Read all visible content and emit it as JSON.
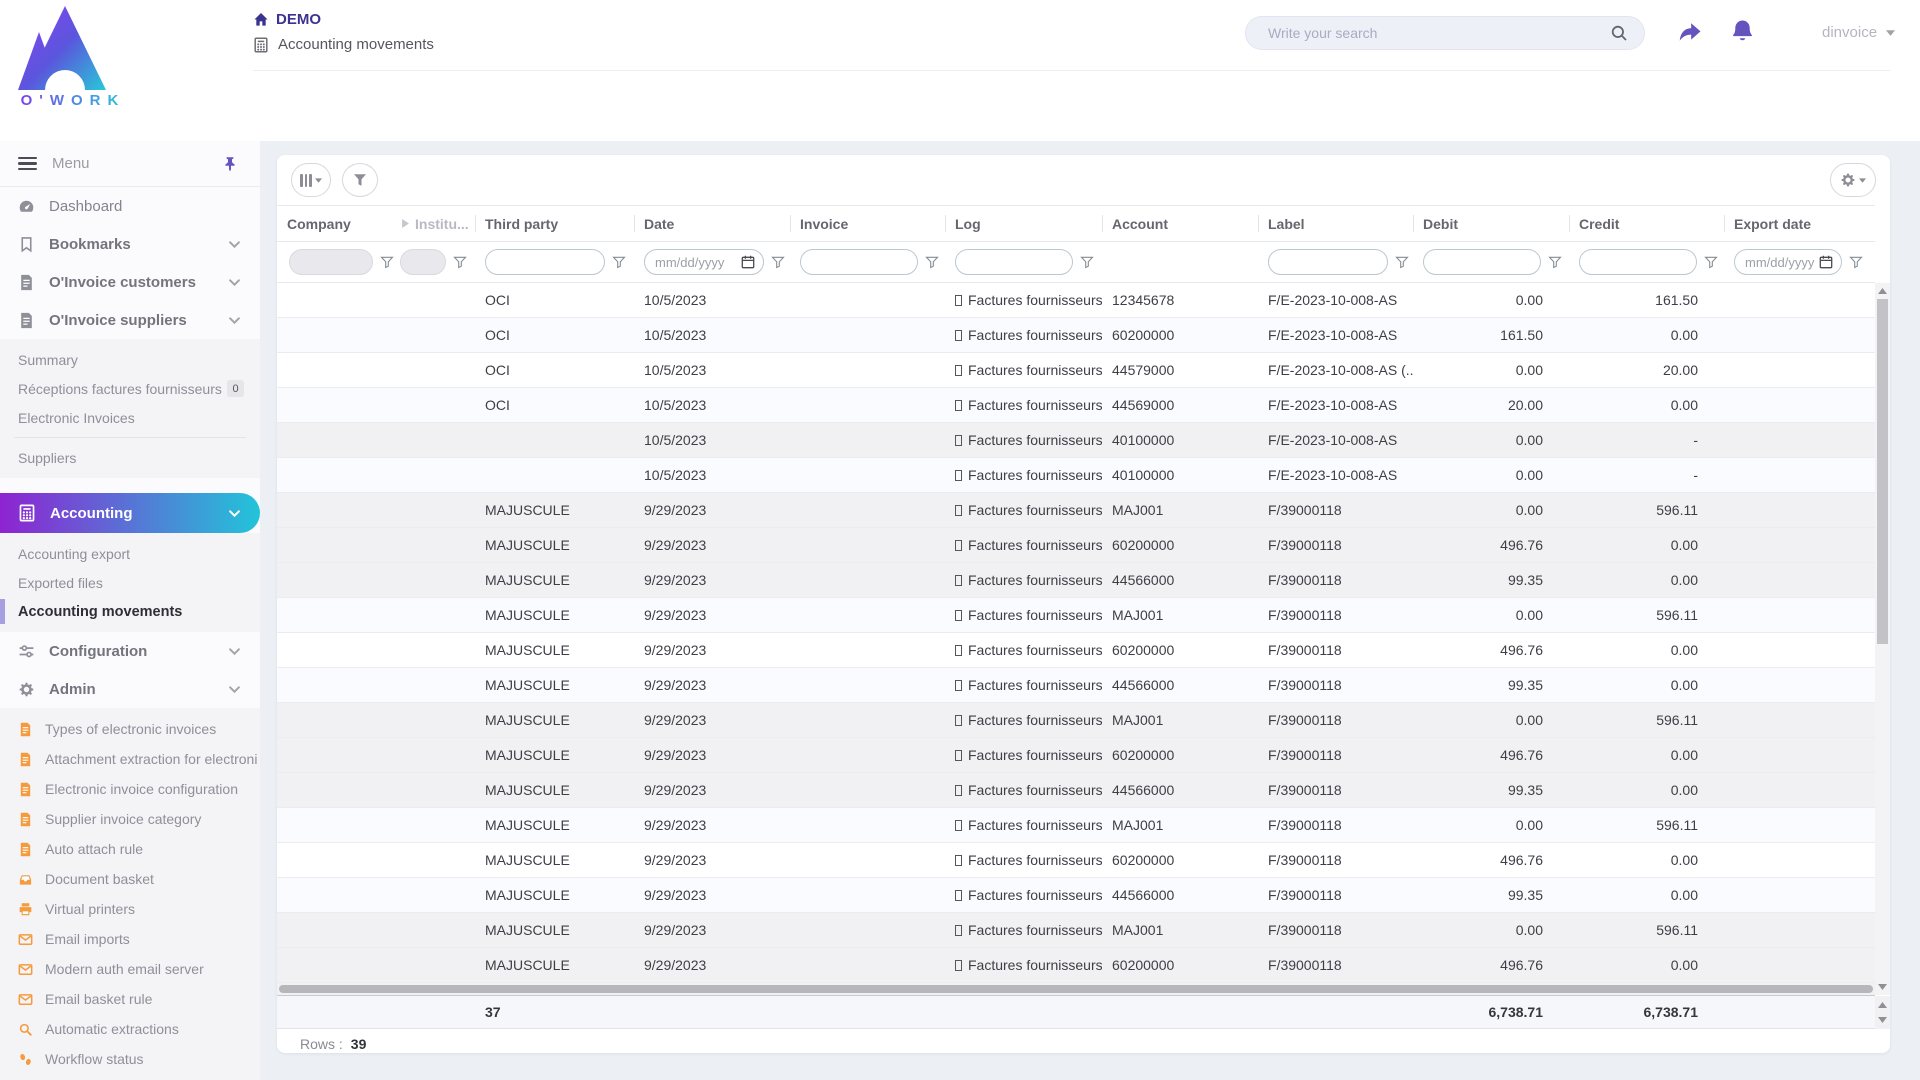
{
  "colors": {
    "accent_purple": "#6554c0",
    "grad_start": "#8e23d2",
    "grad_end": "#22c4d9",
    "breadcrumb_title": "#3b3390",
    "admin_orange": "#f39b3d",
    "active_bar": "#a89fe0"
  },
  "topbar": {
    "logo_text": "O'WORK",
    "breadcrumb_title": "DEMO",
    "breadcrumb_page": "Accounting movements",
    "search_placeholder": "Write your search",
    "username": "dinvoice"
  },
  "sidebar": {
    "menu_label": "Menu",
    "dashboard": "Dashboard",
    "bookmarks": "Bookmarks",
    "oinvoice_customers": "O'Invoice customers",
    "oinvoice_suppliers": "O'Invoice suppliers",
    "suppliers_submenu": [
      {
        "label": "Summary"
      },
      {
        "label": "Réceptions factures fournisseurs",
        "badge": "0"
      },
      {
        "label": "Electronic Invoices"
      },
      {
        "divider": true
      },
      {
        "label": "Suppliers"
      }
    ],
    "accounting": "Accounting",
    "accounting_submenu": [
      {
        "label": "Accounting export"
      },
      {
        "label": "Exported files"
      },
      {
        "label": "Accounting movements",
        "active": true
      }
    ],
    "configuration": "Configuration",
    "admin": "Admin",
    "admin_submenu": [
      {
        "label": "Types of electronic invoices",
        "icon": "doc"
      },
      {
        "label": "Attachment extraction for electroni",
        "icon": "doc"
      },
      {
        "label": "Electronic invoice configuration",
        "icon": "doc"
      },
      {
        "label": "Supplier invoice category",
        "icon": "doc"
      },
      {
        "label": "Auto attach rule",
        "icon": "doc"
      },
      {
        "label": "Document basket",
        "icon": "basket"
      },
      {
        "label": "Virtual printers",
        "icon": "printer"
      },
      {
        "label": "Email imports",
        "icon": "mail"
      },
      {
        "label": "Modern auth email server",
        "icon": "mail"
      },
      {
        "label": "Email basket rule",
        "icon": "mail"
      },
      {
        "label": "Automatic extractions",
        "icon": "searchglass"
      },
      {
        "label": "Workflow status",
        "icon": "steps"
      }
    ]
  },
  "table": {
    "columns": [
      {
        "key": "company",
        "label": "Company"
      },
      {
        "key": "institution",
        "label": "Institu..."
      },
      {
        "key": "third_party",
        "label": "Third party"
      },
      {
        "key": "date",
        "label": "Date"
      },
      {
        "key": "invoice",
        "label": "Invoice"
      },
      {
        "key": "log",
        "label": "Log"
      },
      {
        "key": "account",
        "label": "Account"
      },
      {
        "key": "label",
        "label": "Label"
      },
      {
        "key": "debit",
        "label": "Debit"
      },
      {
        "key": "credit",
        "label": "Credit"
      },
      {
        "key": "export_date",
        "label": "Export date"
      }
    ],
    "date_placeholder": "mm/dd/yyyy",
    "rows": [
      {
        "company": "",
        "institution": "",
        "third_party": "OCI",
        "date": "10/5/2023",
        "invoice": "",
        "log": "Factures fournisseurs",
        "account": "12345678",
        "label": "F/E-2023-10-008-AS",
        "debit": "0.00",
        "credit": "161.50",
        "export_date": "",
        "shade": "w"
      },
      {
        "company": "",
        "institution": "",
        "third_party": "OCI",
        "date": "10/5/2023",
        "invoice": "",
        "log": "Factures fournisseurs",
        "account": "60200000",
        "label": "F/E-2023-10-008-AS",
        "debit": "161.50",
        "credit": "0.00",
        "export_date": "",
        "shade": "l"
      },
      {
        "company": "",
        "institution": "",
        "third_party": "OCI",
        "date": "10/5/2023",
        "invoice": "",
        "log": "Factures fournisseurs",
        "account": "44579000",
        "label": "F/E-2023-10-008-AS (...",
        "debit": "0.00",
        "credit": "20.00",
        "export_date": "",
        "shade": "w"
      },
      {
        "company": "",
        "institution": "",
        "third_party": "OCI",
        "date": "10/5/2023",
        "invoice": "",
        "log": "Factures fournisseurs",
        "account": "44569000",
        "label": "F/E-2023-10-008-AS",
        "debit": "20.00",
        "credit": "0.00",
        "export_date": "",
        "shade": "l"
      },
      {
        "company": "",
        "institution": "",
        "third_party": "",
        "date": "10/5/2023",
        "invoice": "",
        "log": "Factures fournisseurs",
        "account": "40100000",
        "label": "F/E-2023-10-008-AS",
        "debit": "0.00",
        "credit": "-",
        "export_date": "",
        "shade": "g"
      },
      {
        "company": "",
        "institution": "",
        "third_party": "",
        "date": "10/5/2023",
        "invoice": "",
        "log": "Factures fournisseurs",
        "account": "40100000",
        "label": "F/E-2023-10-008-AS",
        "debit": "0.00",
        "credit": "-",
        "export_date": "",
        "shade": "l"
      },
      {
        "company": "",
        "institution": "",
        "third_party": "MAJUSCULE",
        "date": "9/29/2023",
        "invoice": "",
        "log": "Factures fournisseurs",
        "account": "MAJ001",
        "label": "F/39000118",
        "debit": "0.00",
        "credit": "596.11",
        "export_date": "",
        "shade": "g"
      },
      {
        "company": "",
        "institution": "",
        "third_party": "MAJUSCULE",
        "date": "9/29/2023",
        "invoice": "",
        "log": "Factures fournisseurs",
        "account": "60200000",
        "label": "F/39000118",
        "debit": "496.76",
        "credit": "0.00",
        "export_date": "",
        "shade": "g"
      },
      {
        "company": "",
        "institution": "",
        "third_party": "MAJUSCULE",
        "date": "9/29/2023",
        "invoice": "",
        "log": "Factures fournisseurs",
        "account": "44566000",
        "label": "F/39000118",
        "debit": "99.35",
        "credit": "0.00",
        "export_date": "",
        "shade": "g"
      },
      {
        "company": "",
        "institution": "",
        "third_party": "MAJUSCULE",
        "date": "9/29/2023",
        "invoice": "",
        "log": "Factures fournisseurs",
        "account": "MAJ001",
        "label": "F/39000118",
        "debit": "0.00",
        "credit": "596.11",
        "export_date": "",
        "shade": "l"
      },
      {
        "company": "",
        "institution": "",
        "third_party": "MAJUSCULE",
        "date": "9/29/2023",
        "invoice": "",
        "log": "Factures fournisseurs",
        "account": "60200000",
        "label": "F/39000118",
        "debit": "496.76",
        "credit": "0.00",
        "export_date": "",
        "shade": "w"
      },
      {
        "company": "",
        "institution": "",
        "third_party": "MAJUSCULE",
        "date": "9/29/2023",
        "invoice": "",
        "log": "Factures fournisseurs",
        "account": "44566000",
        "label": "F/39000118",
        "debit": "99.35",
        "credit": "0.00",
        "export_date": "",
        "shade": "l"
      },
      {
        "company": "",
        "institution": "",
        "third_party": "MAJUSCULE",
        "date": "9/29/2023",
        "invoice": "",
        "log": "Factures fournisseurs",
        "account": "MAJ001",
        "label": "F/39000118",
        "debit": "0.00",
        "credit": "596.11",
        "export_date": "",
        "shade": "g"
      },
      {
        "company": "",
        "institution": "",
        "third_party": "MAJUSCULE",
        "date": "9/29/2023",
        "invoice": "",
        "log": "Factures fournisseurs",
        "account": "60200000",
        "label": "F/39000118",
        "debit": "496.76",
        "credit": "0.00",
        "export_date": "",
        "shade": "g"
      },
      {
        "company": "",
        "institution": "",
        "third_party": "MAJUSCULE",
        "date": "9/29/2023",
        "invoice": "",
        "log": "Factures fournisseurs",
        "account": "44566000",
        "label": "F/39000118",
        "debit": "99.35",
        "credit": "0.00",
        "export_date": "",
        "shade": "g"
      },
      {
        "company": "",
        "institution": "",
        "third_party": "MAJUSCULE",
        "date": "9/29/2023",
        "invoice": "",
        "log": "Factures fournisseurs",
        "account": "MAJ001",
        "label": "F/39000118",
        "debit": "0.00",
        "credit": "596.11",
        "export_date": "",
        "shade": "l"
      },
      {
        "company": "",
        "institution": "",
        "third_party": "MAJUSCULE",
        "date": "9/29/2023",
        "invoice": "",
        "log": "Factures fournisseurs",
        "account": "60200000",
        "label": "F/39000118",
        "debit": "496.76",
        "credit": "0.00",
        "export_date": "",
        "shade": "w"
      },
      {
        "company": "",
        "institution": "",
        "third_party": "MAJUSCULE",
        "date": "9/29/2023",
        "invoice": "",
        "log": "Factures fournisseurs",
        "account": "44566000",
        "label": "F/39000118",
        "debit": "99.35",
        "credit": "0.00",
        "export_date": "",
        "shade": "l"
      },
      {
        "company": "",
        "institution": "",
        "third_party": "MAJUSCULE",
        "date": "9/29/2023",
        "invoice": "",
        "log": "Factures fournisseurs",
        "account": "MAJ001",
        "label": "F/39000118",
        "debit": "0.00",
        "credit": "596.11",
        "export_date": "",
        "shade": "g"
      },
      {
        "company": "",
        "institution": "",
        "third_party": "MAJUSCULE",
        "date": "9/29/2023",
        "invoice": "",
        "log": "Factures fournisseurs",
        "account": "60200000",
        "label": "F/39000118",
        "debit": "496.76",
        "credit": "0.00",
        "export_date": "",
        "shade": "g"
      }
    ],
    "totals": {
      "third_party": "37",
      "debit": "6,738.71",
      "credit": "6,738.71"
    },
    "rows_label": "Rows :",
    "rows_count": "39"
  }
}
